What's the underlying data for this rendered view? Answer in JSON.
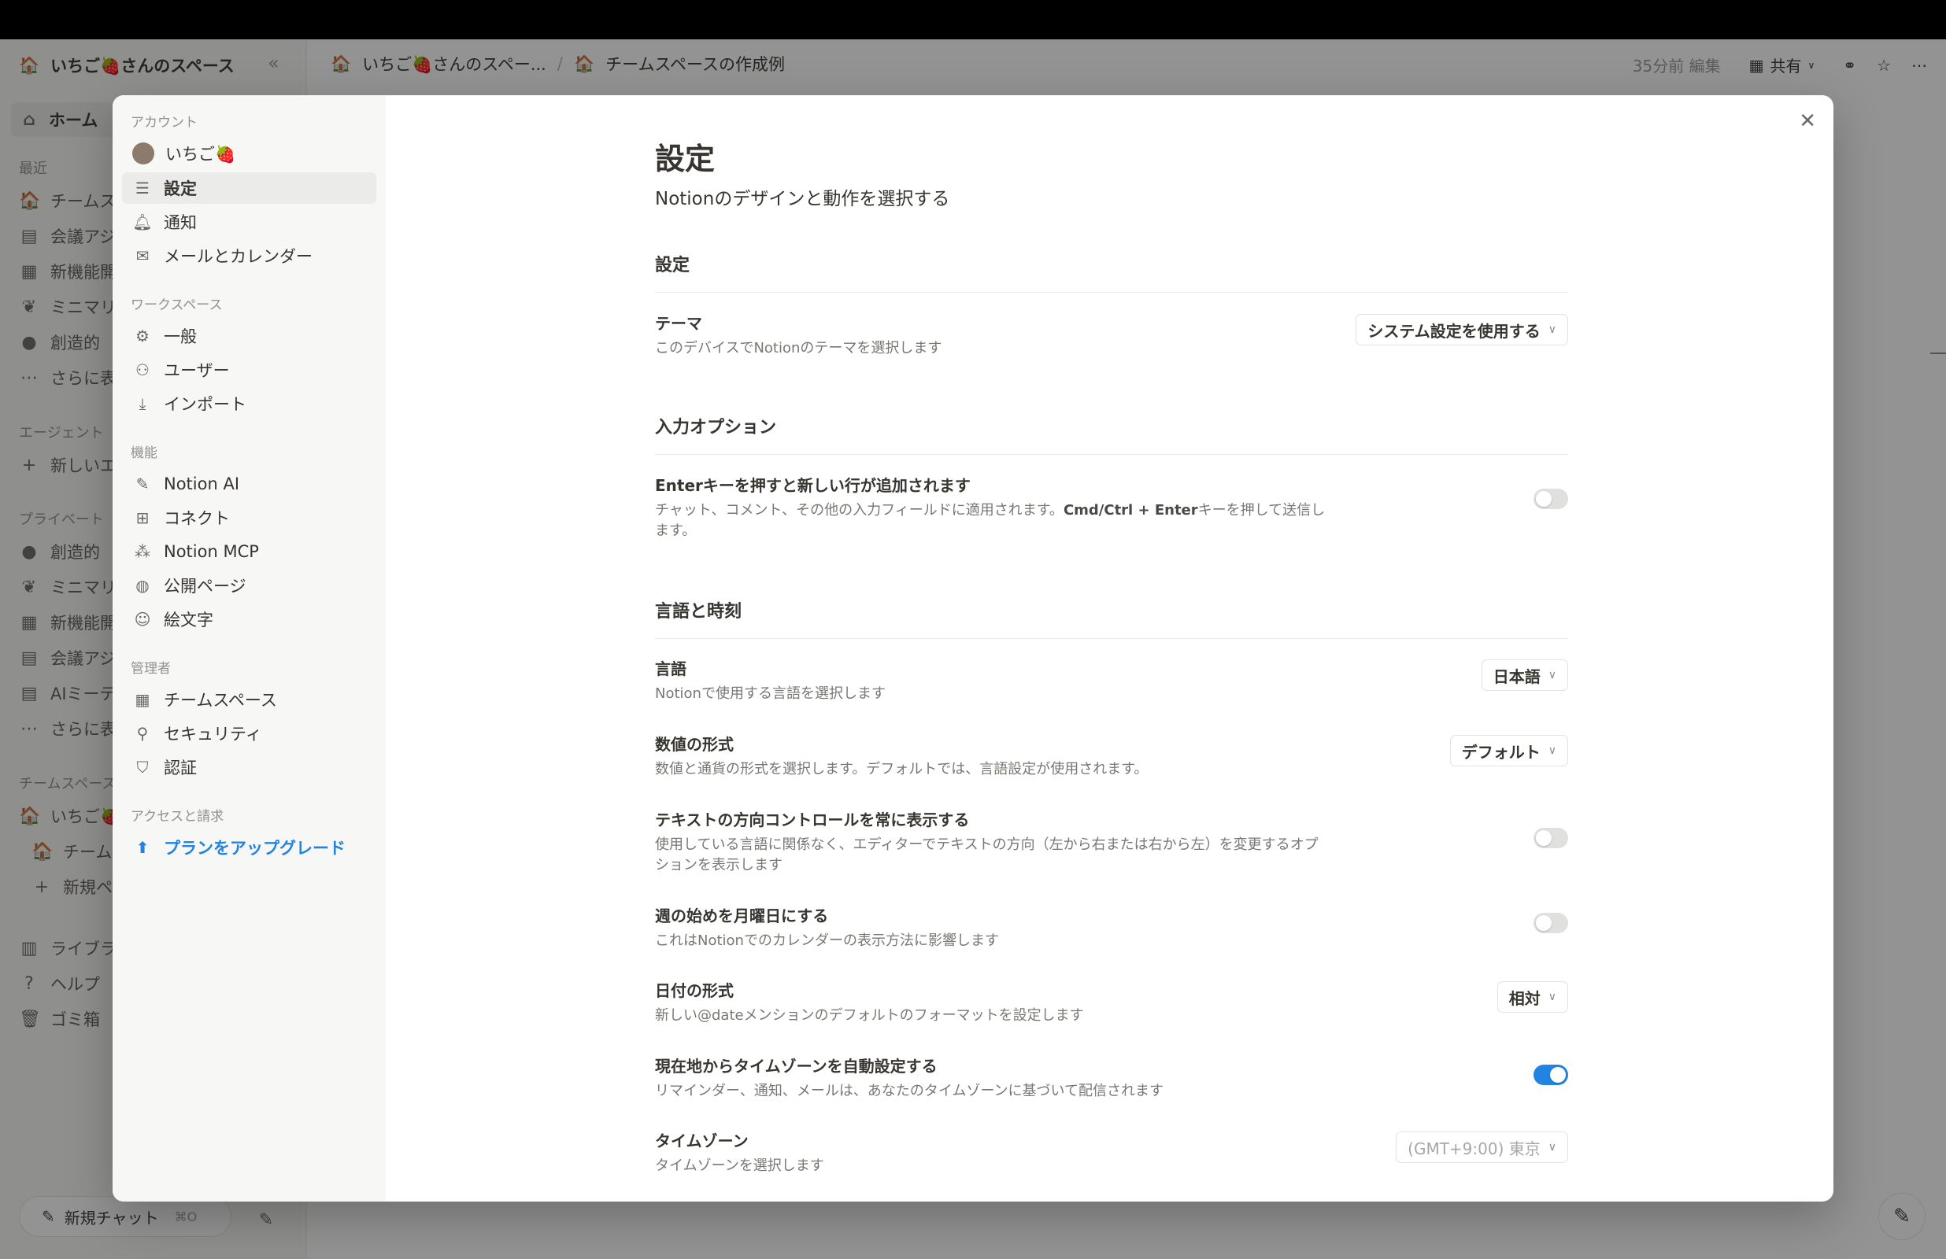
{
  "app": {
    "workspace_name": "いちご🍓さんのスペース",
    "home_label": "ホーム",
    "recent_label": "最近",
    "recent_items": [
      "チームスペースの作成例",
      "会議アジェンダ",
      "新機能開発",
      "ミニマリスト",
      "創造的"
    ],
    "more_label": "さらに表示",
    "agents_label": "エージェント",
    "new_agent_label": "新しいエージェント",
    "private_label": "プライベート",
    "private_items": [
      "創造的",
      "ミニマリスト",
      "新機能開発",
      "会議アジェンダ",
      "AIミーティング"
    ],
    "teamspaces_label": "チームスペース",
    "team_items": [
      "いちご🍓さんのスペース",
      "チームスペースの作成例"
    ],
    "new_page_label": "新規ページ",
    "library_label": "ライブラリ",
    "help_label": "ヘルプ",
    "trash_label": "ゴミ箱",
    "new_chat_label": "新規チャット",
    "new_chat_shortcut": "⌘O",
    "breadcrumb_1": "いちご🍓さんのスペー...",
    "breadcrumb_sep": "/",
    "breadcrumb_2": "チームスペースの作成例",
    "edited": "35分前 編集",
    "share_label": "共有"
  },
  "nav": {
    "account_section": "アカウント",
    "user_name": "いちご🍓",
    "settings": "設定",
    "notifications": "通知",
    "mail_calendar": "メールとカレンダー",
    "workspace_section": "ワークスペース",
    "general": "一般",
    "users": "ユーザー",
    "import": "インポート",
    "features_section": "機能",
    "notion_ai": "Notion AI",
    "connect": "コネクト",
    "notion_mcp": "Notion MCP",
    "public_pages": "公開ページ",
    "emoji": "絵文字",
    "admin_section": "管理者",
    "teamspaces": "チームスペース",
    "security": "セキュリティ",
    "identity": "認証",
    "access_section": "アクセスと請求",
    "upgrade": "プランをアップグレード"
  },
  "settings": {
    "title": "設定",
    "subtitle": "Notionのデザインと動作を選択する",
    "section_prefs": "設定",
    "theme_label": "テーマ",
    "theme_desc": "このデバイスでNotionのテーマを選択します",
    "theme_value": "システム設定を使用する",
    "section_input": "入力オプション",
    "enter_label": "Enterキーを押すと新しい行が追加されます",
    "enter_desc_1": "チャット、コメント、その他の入力フィールドに適用されます。",
    "enter_desc_bold": "Cmd/Ctrl + Enter",
    "enter_desc_2": "キーを押して送信します。",
    "enter_toggle": false,
    "section_lang": "言語と時刻",
    "language_label": "言語",
    "language_desc": "Notionで使用する言語を選択します",
    "language_value": "日本語",
    "number_label": "数値の形式",
    "number_desc": "数値と通貨の形式を選択します。デフォルトでは、言語設定が使用されます。",
    "number_value": "デフォルト",
    "direction_label": "テキストの方向コントロールを常に表示する",
    "direction_desc": "使用している言語に関係なく、エディターでテキストの方向（左から右または右から左）を変更するオプションを表示します",
    "direction_toggle": false,
    "week_label": "週の始めを月曜日にする",
    "week_desc": "これはNotionでのカレンダーの表示方法に影響します",
    "week_toggle": false,
    "date_label": "日付の形式",
    "date_desc": "新しい@dateメンションのデフォルトのフォーマットを設定します",
    "date_value": "相対",
    "autotz_label": "現在地からタイムゾーンを自動設定する",
    "autotz_desc": "リマインダー、通知、メールは、あなたのタイムゾーンに基づいて配信されます",
    "autotz_toggle": true,
    "tz_label": "タイムゾーン",
    "tz_desc": "タイムゾーンを選択します",
    "tz_value": "(GMT+9:00) 東京"
  },
  "colors": {
    "accent": "#2383e2",
    "text": "#37352f",
    "muted": "#787774"
  }
}
